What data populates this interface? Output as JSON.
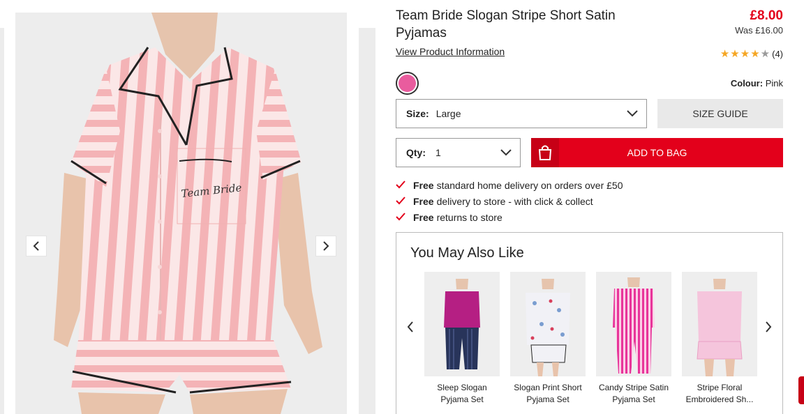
{
  "product": {
    "title": "Team Bride Slogan Stripe Short Satin Pyjamas",
    "price": "£8.00",
    "was_price": "Was £16.00",
    "view_info_link": "View Product Information",
    "rating_value": 4,
    "rating_max": 5,
    "review_count": "(4)",
    "colour_label": "Colour:",
    "colour_value": "Pink",
    "swatch_color": "#e95c9e",
    "image_text": "Team Bride"
  },
  "size": {
    "label": "Size:",
    "value": "Large"
  },
  "size_guide_label": "SIZE GUIDE",
  "qty": {
    "label": "Qty:",
    "value": "1"
  },
  "add_to_bag_label": "ADD TO BAG",
  "delivery": [
    {
      "bold": "Free",
      "text": "standard home delivery on orders over £50"
    },
    {
      "bold": "Free",
      "text": "delivery to store - with click & collect"
    },
    {
      "bold": "Free",
      "text": "returns to store"
    }
  ],
  "recommendations": {
    "title": "You May Also Like",
    "items": [
      {
        "line1": "Sleep Slogan",
        "line2": "Pyjama Set"
      },
      {
        "line1": "Slogan Print Short",
        "line2": "Pyjama Set"
      },
      {
        "line1": "Candy Stripe Satin",
        "line2": "Pyjama Set"
      },
      {
        "line1": "Stripe Floral",
        "line2": "Embroidered Sh..."
      }
    ]
  },
  "colors": {
    "accent": "#e3001b",
    "accent_dark": "#c70016",
    "stripe_pink": "#f4b3b6"
  },
  "icons": [
    "chevron-left-icon",
    "chevron-right-icon",
    "chevron-down-icon",
    "bag-icon",
    "check-icon",
    "star-icon"
  ]
}
